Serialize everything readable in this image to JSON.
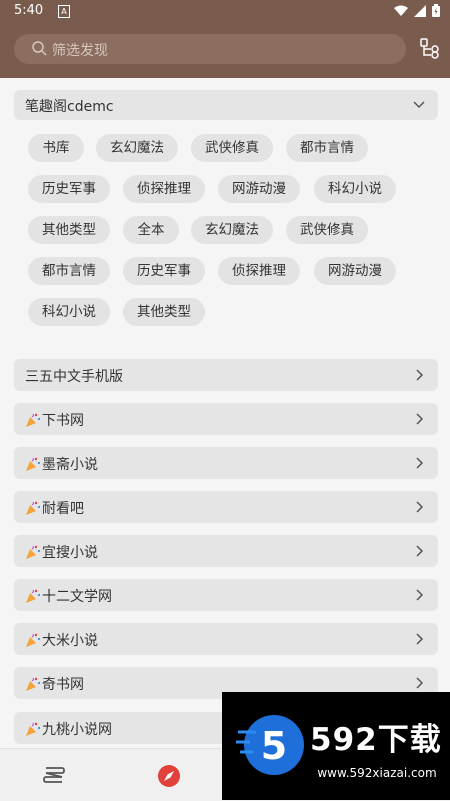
{
  "status": {
    "time": "5:40",
    "notif": "A"
  },
  "search": {
    "placeholder": "筛选发现"
  },
  "group": {
    "title": "笔趣阁cdemc"
  },
  "tags": [
    "书库",
    "玄幻魔法",
    "武侠修真",
    "都市言情",
    "历史军事",
    "侦探推理",
    "网游动漫",
    "科幻小说",
    "其他类型",
    "全本",
    "玄幻魔法",
    "武侠修真",
    "都市言情",
    "历史军事",
    "侦探推理",
    "网游动漫",
    "科幻小说",
    "其他类型"
  ],
  "sources": [
    {
      "label": "三五中文手机版",
      "icon": ""
    },
    {
      "label": "下书网",
      "icon": "party-popper-icon"
    },
    {
      "label": "墨斋小说",
      "icon": "party-popper-icon"
    },
    {
      "label": "耐看吧",
      "icon": "party-popper-icon"
    },
    {
      "label": "宜搜小说",
      "icon": "party-popper-icon"
    },
    {
      "label": "十二文学网",
      "icon": "party-popper-icon"
    },
    {
      "label": "大米小说",
      "icon": "party-popper-icon"
    },
    {
      "label": "奇书网",
      "icon": "party-popper-icon"
    },
    {
      "label": "九桃小说网",
      "icon": "party-popper-icon"
    }
  ],
  "bottom_nav": {
    "items": [
      "bookshelf-icon",
      "explore-icon"
    ]
  },
  "watermark": {
    "brand": "592下载",
    "url": "www.592xiazai.com",
    "logo_digit": "5"
  },
  "colors": {
    "appbar": "#7a5c4e",
    "search_bg": "#8b6e60",
    "accent": "#e0413a"
  }
}
